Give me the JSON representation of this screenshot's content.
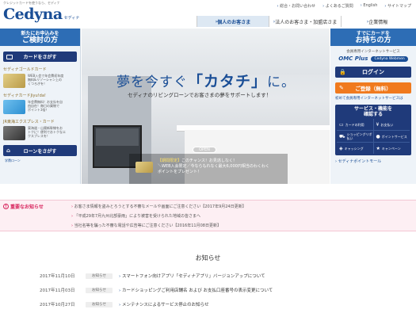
{
  "header": {
    "tagline": "クレジットカードを使うなら、セディナ",
    "logo_word": "Cedyna",
    "logo_sub": "セディナ",
    "util_links": [
      "総合・お問い合わせ",
      "よくあるご質問",
      "English",
      "サイトマップ"
    ],
    "tabs": [
      {
        "label": "個人のお客さま",
        "active": true
      },
      {
        "label": "法人のお客さま・加盟店さま",
        "active": false
      },
      {
        "label": "企業情報",
        "active": false
      }
    ]
  },
  "left": {
    "head_line1": "新たにお申込みを",
    "head_line2": "ご検討の方",
    "find_card_label": "カードをさがす",
    "cards": [
      {
        "title": "セディナゴールドカード",
        "desc": [
          "WEB入会で年会費初年度",
          "無料&リゾーシャン上の",
          "くつろぎを！"
        ],
        "color": "#c9a94e"
      },
      {
        "title": "セディナカードJiyu!da!",
        "desc": [
          "年会費無料！お支払を自",
          "由自在！毎日の買物で",
          "ポイント3倍！"
        ],
        "color": "#2d8fd1"
      },
      {
        "title": "JR東海エクスプレス・カード",
        "desc": [
          "東海道・山陽新幹線をお",
          "トクに！便利でおトクなエ",
          "クスプレスを！"
        ],
        "color": "#4a4a4a"
      }
    ],
    "find_loan_label": "ローンをさがす",
    "footer_link": "学費ローン"
  },
  "hero": {
    "title_pre": "夢を今すぐ",
    "title_main": "「カタチ」",
    "title_post": "に。",
    "subtitle": "セディナのリビングローンでお客さまの夢をサポートします！",
    "open_label": "OPEN",
    "promo_line1_hl": "【期間限定】",
    "promo_line1": "このチャンス！お見逃しなく！",
    "promo_line2": "＼WEB入会限定／今ならもれなく最大6,000円相当のわくわく",
    "promo_line3": "ポイントをプレゼント！"
  },
  "right": {
    "head_line1": "すでにカードを",
    "head_line2": "お持ちの方",
    "service_name": "会員専用インターネットサービス",
    "omc_label": "OMC Plus",
    "webmen_label": "Cedyna Webmen",
    "login_label": "ログイン",
    "register_label": "ご登録（無料）",
    "first_time": "初めて会員専用インターネットサービスは",
    "svc_head_line1": "サービス・機能を",
    "svc_head_line2": "確認する",
    "services": [
      {
        "label": "カードの利用",
        "icon": "card-icon"
      },
      {
        "label": "お支払い",
        "icon": "yen-icon"
      },
      {
        "label": "ショッピングリボ払い",
        "icon": "cart-icon"
      },
      {
        "label": "ポイントサービス",
        "icon": "point-icon"
      },
      {
        "label": "キャッシング",
        "icon": "cash-icon"
      },
      {
        "label": "キャンペーン",
        "icon": "campaign-icon"
      }
    ],
    "point_link": "セディナポイントモール"
  },
  "notices": {
    "label": "重要なお知らせ",
    "items": [
      "お客さま情報を盗みとろうとする不審なメールや画面にご注意ください【2017年9月24日更新】",
      "「平成29年7月九州北部豪雨」により被害を受けられた地域の皆さまへ",
      "当社名等を騙った不審な電話や広告等にご注意ください【2016年11月08日更新】"
    ]
  },
  "news": {
    "title": "お知らせ",
    "items": [
      {
        "date": "2017年11月10日",
        "category": "お知らせ",
        "text": "スマートフォン向けアプリ「セディナアプリ」バージョンアップについて"
      },
      {
        "date": "2017年11月03日",
        "category": "お知らせ",
        "text": "カードショッピングご利用店舗名 および お支払口座番号の表示変更について"
      },
      {
        "date": "2017年10月27日",
        "category": "お知らせ",
        "text": "メンテナンスによるサービス停止のお知らせ"
      }
    ]
  }
}
